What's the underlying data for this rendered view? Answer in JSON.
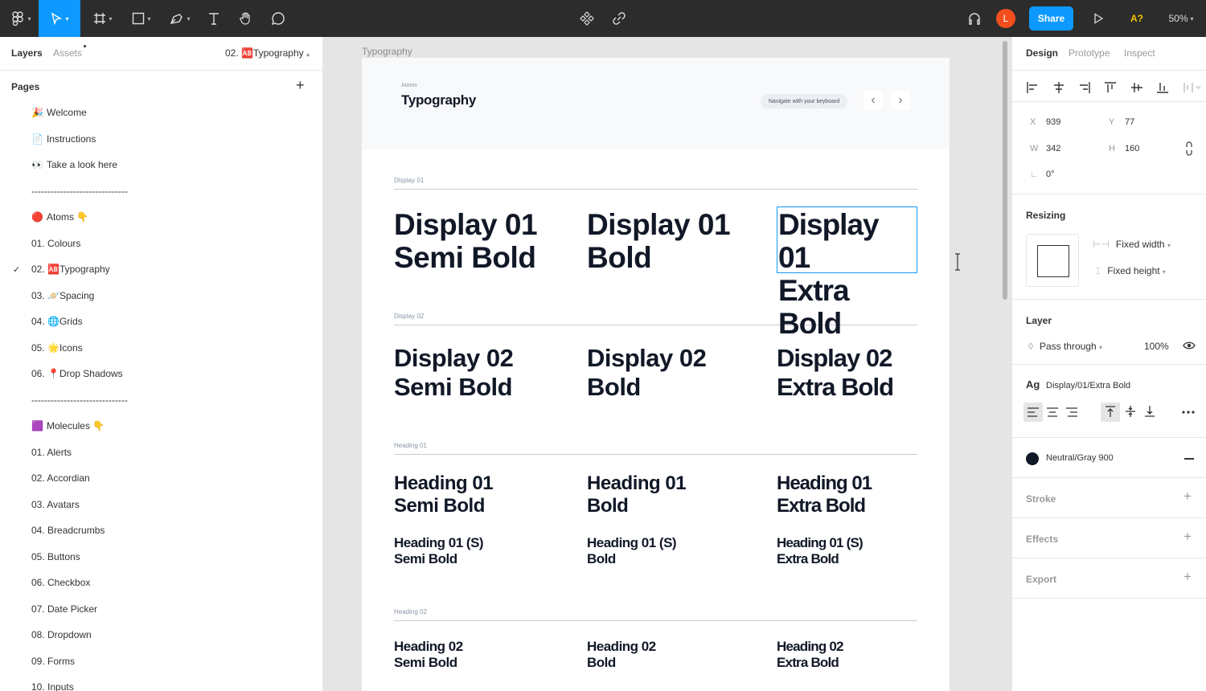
{
  "topbar": {
    "share_label": "Share",
    "avatar_letter": "L",
    "spellcheck_label": "A?",
    "zoom_label": "50%"
  },
  "layers_panel": {
    "tab_layers": "Layers",
    "tab_assets": "Assets",
    "current_page": "02. 🆎Typography",
    "pages_label": "Pages",
    "add_icon": "+",
    "pages": [
      {
        "label": "Welcome",
        "icon": "🎉"
      },
      {
        "label": "Instructions",
        "icon": "📄"
      },
      {
        "label": "Take a look here",
        "icon": "👀"
      },
      {
        "label": "------------------------------",
        "icon": ""
      },
      {
        "label": "Atoms 👇",
        "icon": "🔴"
      },
      {
        "label": "01. Colours",
        "icon": ""
      },
      {
        "label": "02. 🆎Typography",
        "icon": "",
        "selected": true
      },
      {
        "label": "03. 🪐Spacing",
        "icon": ""
      },
      {
        "label": "04. 🌐Grids",
        "icon": ""
      },
      {
        "label": "05. 🌟Icons",
        "icon": ""
      },
      {
        "label": "06. 📍Drop Shadows",
        "icon": ""
      },
      {
        "label": "------------------------------",
        "icon": ""
      },
      {
        "label": "Molecules 👇",
        "icon": "🟪"
      },
      {
        "label": "01.  Alerts",
        "icon": ""
      },
      {
        "label": "02.  Accordian",
        "icon": ""
      },
      {
        "label": "03.  Avatars",
        "icon": ""
      },
      {
        "label": "04.  Breadcrumbs",
        "icon": ""
      },
      {
        "label": "05.  Buttons",
        "icon": ""
      },
      {
        "label": "06.  Checkbox",
        "icon": ""
      },
      {
        "label": "07.  Date Picker",
        "icon": ""
      },
      {
        "label": "08.  Dropdown",
        "icon": ""
      },
      {
        "label": "09.  Forms",
        "icon": ""
      },
      {
        "label": "10.  Inputs",
        "icon": ""
      }
    ]
  },
  "canvas": {
    "frame_title": "Typography",
    "header": {
      "eyebrow": "Atoms",
      "title": "Typography",
      "hint": "Navigate with your keyboard",
      "prev": "‹",
      "next": "›"
    },
    "sections": [
      {
        "label": "Display 01"
      },
      {
        "label": "Display 02"
      },
      {
        "label": "Heading 01"
      },
      {
        "label": "Heading 02"
      }
    ],
    "samples": {
      "d1_semi": [
        "Display 01",
        "Semi Bold"
      ],
      "d1_bold": [
        "Display 01",
        "Bold"
      ],
      "d1_extra": [
        "Display 01",
        "Extra Bold"
      ],
      "d2_semi": [
        "Display 02",
        "Semi Bold"
      ],
      "d2_bold": [
        "Display 02",
        "Bold"
      ],
      "d2_extra": [
        "Display 02",
        "Extra Bold"
      ],
      "h1_semi": [
        "Heading 01",
        "Semi Bold"
      ],
      "h1_bold": [
        "Heading 01",
        "Bold"
      ],
      "h1_extra": [
        "Heading 01",
        "Extra Bold"
      ],
      "h1s_semi": [
        "Heading 01 (S)",
        "Semi Bold"
      ],
      "h1s_bold": [
        "Heading 01 (S)",
        "Bold"
      ],
      "h1s_extra": [
        "Heading 01 (S)",
        "Extra Bold"
      ],
      "h2_semi": [
        "Heading 02",
        "Semi Bold"
      ],
      "h2_bold": [
        "Heading 02",
        "Bold"
      ],
      "h2_extra": [
        "Heading 02",
        "Extra Bold"
      ]
    }
  },
  "design_panel": {
    "tab_design": "Design",
    "tab_prototype": "Prototype",
    "tab_inspect": "Inspect",
    "x_label": "X",
    "x_value": "939",
    "y_label": "Y",
    "y_value": "77",
    "w_label": "W",
    "w_value": "342",
    "h_label": "H",
    "h_value": "160",
    "rotation_value": "0°",
    "resizing_label": "Resizing",
    "fixed_width": "Fixed width",
    "fixed_height": "Fixed height",
    "layer_label": "Layer",
    "blend_mode": "Pass through",
    "opacity": "100%",
    "text_style_glyph": "Ag",
    "text_style": "Display/01/Extra Bold",
    "fill_name": "Neutral/Gray 900",
    "fill_color": "#111827",
    "stroke_label": "Stroke",
    "effects_label": "Effects",
    "export_label": "Export"
  },
  "colors": {
    "accent": "#0d99ff",
    "avatar": "#f24e1e",
    "spellcheck": "#f5c400",
    "topbar": "#2c2c2c"
  }
}
